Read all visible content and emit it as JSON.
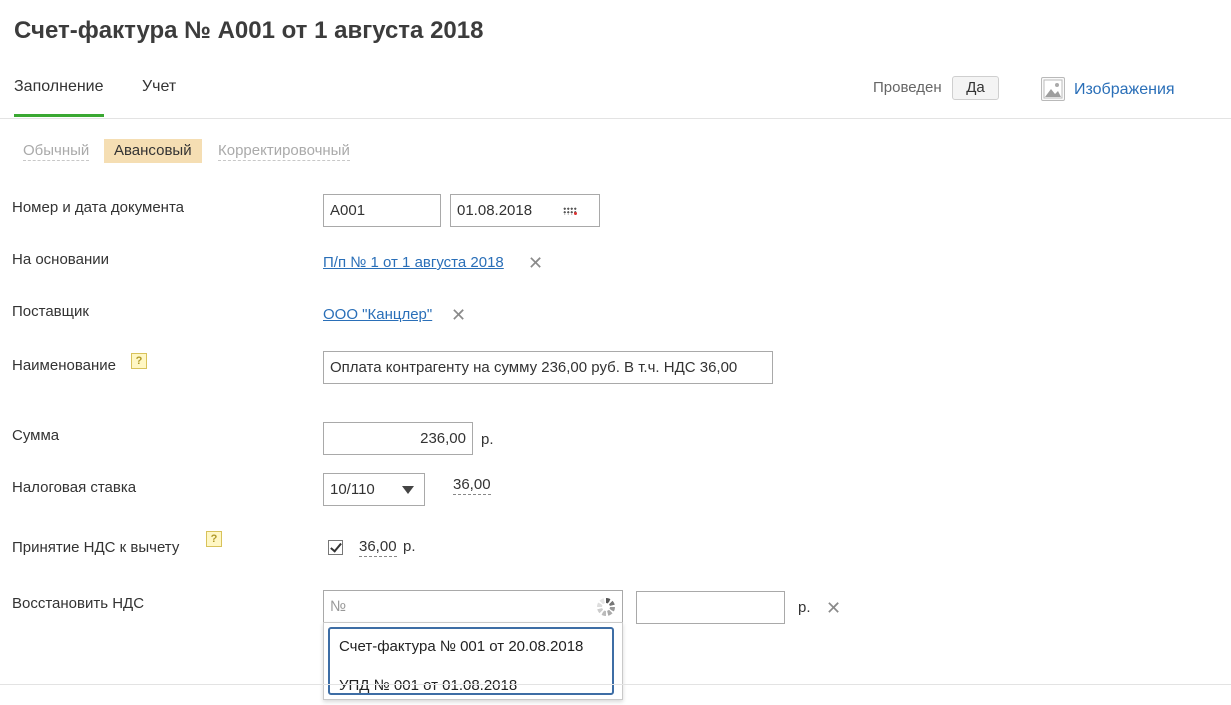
{
  "page": {
    "title": "Счет-фактура № А001 от 1 августа 2018"
  },
  "tabs": [
    {
      "label": "Заполнение",
      "active": true
    },
    {
      "label": "Учет",
      "active": false
    }
  ],
  "header": {
    "posted_label": "Проведен",
    "posted_value": "Да",
    "images_icon": "image-icon",
    "images_link": "Изображения"
  },
  "invoice_kinds": [
    {
      "label": "Обычный",
      "active": false
    },
    {
      "label": "Авансовый",
      "active": true
    },
    {
      "label": "Корректировочный",
      "active": false
    }
  ],
  "form": {
    "doc_number_label": "Номер и дата документа",
    "doc_number": "А001",
    "doc_date": "01.08.2018",
    "basis_label": "На основании",
    "basis_link": "П/п № 1 от 1 августа 2018",
    "supplier_label": "Поставщик",
    "supplier_link": "ООО \"Канцлер\"",
    "name_label": "Наименование",
    "help_glyph": "?",
    "name_value": "Оплата контрагенту на сумму 236,00 руб. В т.ч. НДС 36,00",
    "sum_label": "Сумма",
    "sum_value": "236,00",
    "currency_unit": "р.",
    "tax_rate_label": "Налоговая ставка",
    "tax_rate_value": "10/110",
    "tax_amount": "36,00",
    "vat_deduction_label": "Принятие НДС к вычету",
    "vat_deduction_checked": true,
    "vat_deduction_amount": "36,00",
    "restore_vat_label": "Восстановить НДС",
    "restore_vat_placeholder": "№",
    "restore_vat_amount": "",
    "clear_glyph": "✕"
  },
  "dropdown": {
    "items": [
      "Счет-фактура № 001 от 20.08.2018",
      "УПД № 001 от 01.08.2018"
    ]
  },
  "colors": {
    "accent_green": "#3aa832",
    "link_blue": "#2a6fb8",
    "active_kind_bg": "#f5deb3",
    "dropdown_border": "#3d6da5"
  }
}
